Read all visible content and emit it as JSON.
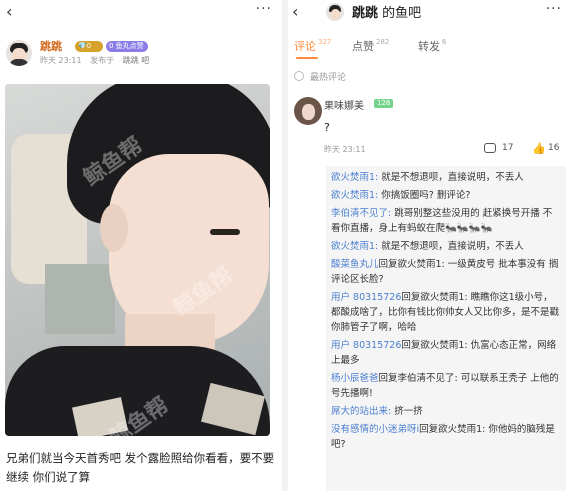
{
  "left": {
    "username": "跳跳",
    "badge1": "💎0",
    "badge2": "0 鱼丸点赞",
    "time": "昨天 23:11",
    "posted_in_label": "发布于",
    "forum": "跳跳 吧",
    "watermark": "鲸鱼帮",
    "caption": "兄弟们就当今天首秀吧 发个露脸照给你看看，要不要继续 你们说了算"
  },
  "right": {
    "title_name": "跳跳",
    "title_suffix": " 的鱼吧",
    "tabs": [
      {
        "label": "评论",
        "count": "327"
      },
      {
        "label": "点赞",
        "count": "282"
      },
      {
        "label": "转发",
        "count": "6"
      }
    ],
    "section_label": "最热评论",
    "comment": {
      "name": "果味娜美",
      "level": "128",
      "text": "?",
      "time": "昨天 23:11",
      "reply_count": "17",
      "like_count": "16"
    },
    "replies": [
      {
        "user": "欲火焚雨1:",
        "text": " 就是不想退呗，直接说明，不丢人"
      },
      {
        "user": "欲火焚雨1:",
        "text": " 你搞饭圈吗? 删评论?"
      },
      {
        "user": "李伯清不见了:",
        "text": " 跳哥别整这些没用的 赶紧换号开播  不看你直播，身上有蚂蚁在爬🐜🐜🐜🐜"
      },
      {
        "user": "欲火焚雨1:",
        "text": " 就是不想退呗，直接说明，不丢人"
      },
      {
        "user": "酸菜鱼丸儿",
        "text": "回复欲火焚雨1: 一级黄皮号  批本事没有  搁评论区长脸?"
      },
      {
        "user": "用户 80315726",
        "text": "回复欲火焚雨1: 瞧瞧你这1级小号，都酸成啥了，比你有钱比你帅女人又比你多，是不是戳你肺管子了啊，哈哈"
      },
      {
        "user": "用户 80315726",
        "text": "回复欲火焚雨1: 仇富心态正常，网络上最多"
      },
      {
        "user": "杨小辰爸爸",
        "text": "回复李伯清不见了: 可以联系王秃子 上他的号先播啊!"
      },
      {
        "user": "屌大的站出来:",
        "text": " 挤一挤"
      },
      {
        "user": "没有感情的小迷弟呀i",
        "text": "回复欲火焚雨1: 你他妈的脑残是吧?"
      }
    ]
  }
}
